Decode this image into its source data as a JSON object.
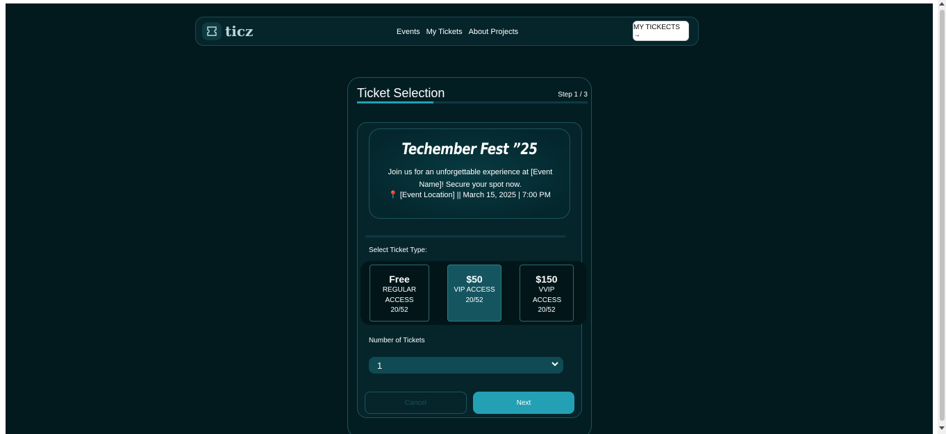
{
  "nav": {
    "logo_text": "ticz",
    "links": [
      "Events",
      "My Tickets",
      "About Projects"
    ],
    "cta": "MY TICKECTS →"
  },
  "card": {
    "title": "Ticket Selection",
    "step": "Step 1 / 3",
    "progress": 0.33
  },
  "event": {
    "title": "Techember Fest ”25",
    "description": "Join us for an unforgettable experience at [Event Name]! Secure your spot now.",
    "location": "[Event Location] || March 15, 2025 | 7:00 PM"
  },
  "tickets": {
    "label": "Select Ticket Type:",
    "options": [
      {
        "price": "Free",
        "name": "REGULAR ACCESS",
        "availability": "20/52",
        "selected": false
      },
      {
        "price": "$50",
        "name": "VIP ACCESS",
        "availability": "20/52",
        "selected": true
      },
      {
        "price": "$150",
        "name": "VVIP ACCESS",
        "availability": "20/52",
        "selected": false
      }
    ]
  },
  "quantity": {
    "label": "Number of Tickets",
    "value": "1"
  },
  "actions": {
    "cancel": "Cancel",
    "next": "Next"
  },
  "colors": {
    "background": "#02191d",
    "accent": "#24a0b5",
    "border": "#1f535b"
  }
}
